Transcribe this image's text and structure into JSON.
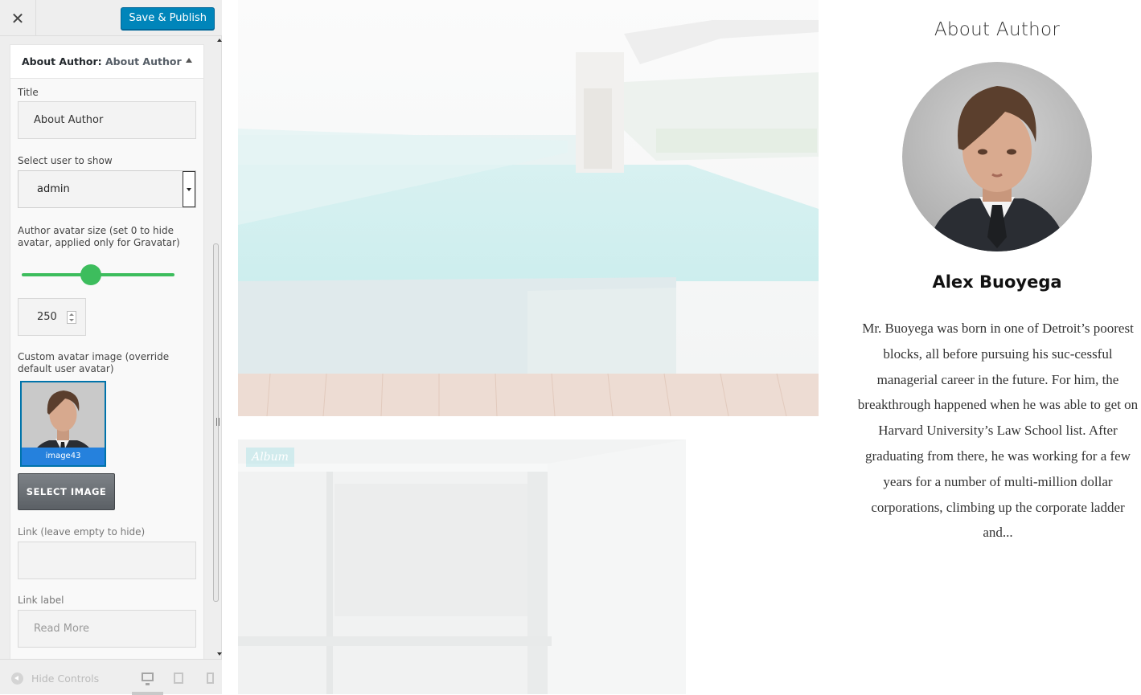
{
  "toolbar": {
    "close_icon": "close-icon",
    "save_label": "Save & Publish"
  },
  "widget": {
    "title_prefix": "About Author:",
    "title_name": "About Author",
    "fields": {
      "title_label": "Title",
      "title_value": "About Author",
      "user_label": "Select user to show",
      "user_value": "admin",
      "avatar_size_label": "Author avatar size (set 0 to hide avatar, applied only for Gravatar)",
      "avatar_size_value": "250",
      "avatar_size_slider_fraction": 0.45,
      "custom_avatar_label": "Custom avatar image (override default user avatar)",
      "custom_avatar_caption": "image43",
      "select_image_label": "SELECT IMAGE",
      "link_label": "Link (leave empty to hide)",
      "link_value": "",
      "link_label_label": "Link label",
      "link_label_placeholder": "Read More"
    }
  },
  "footer": {
    "hide_controls_label": "Hide Controls",
    "devices": [
      "desktop-icon",
      "tablet-icon",
      "mobile-icon"
    ]
  },
  "preview": {
    "album_tag": "Album",
    "about": {
      "heading": "About Author",
      "name": "Alex Buoyega",
      "bio": "Mr. Buoyega was born in one of Detroit’s poorest blocks, all before pursuing his suc-cessful managerial career in the future. For him, the breakthrough happened when he was able to get on Harvard University’s Law School list. After graduating from there, he was working for a few years for a number of multi-million dollar corporations, climbing up the corporate ladder and..."
    }
  },
  "colors": {
    "primary_button": "#0085ba",
    "slider": "#3dbd5d",
    "thumb_caption": "#2581dd"
  }
}
